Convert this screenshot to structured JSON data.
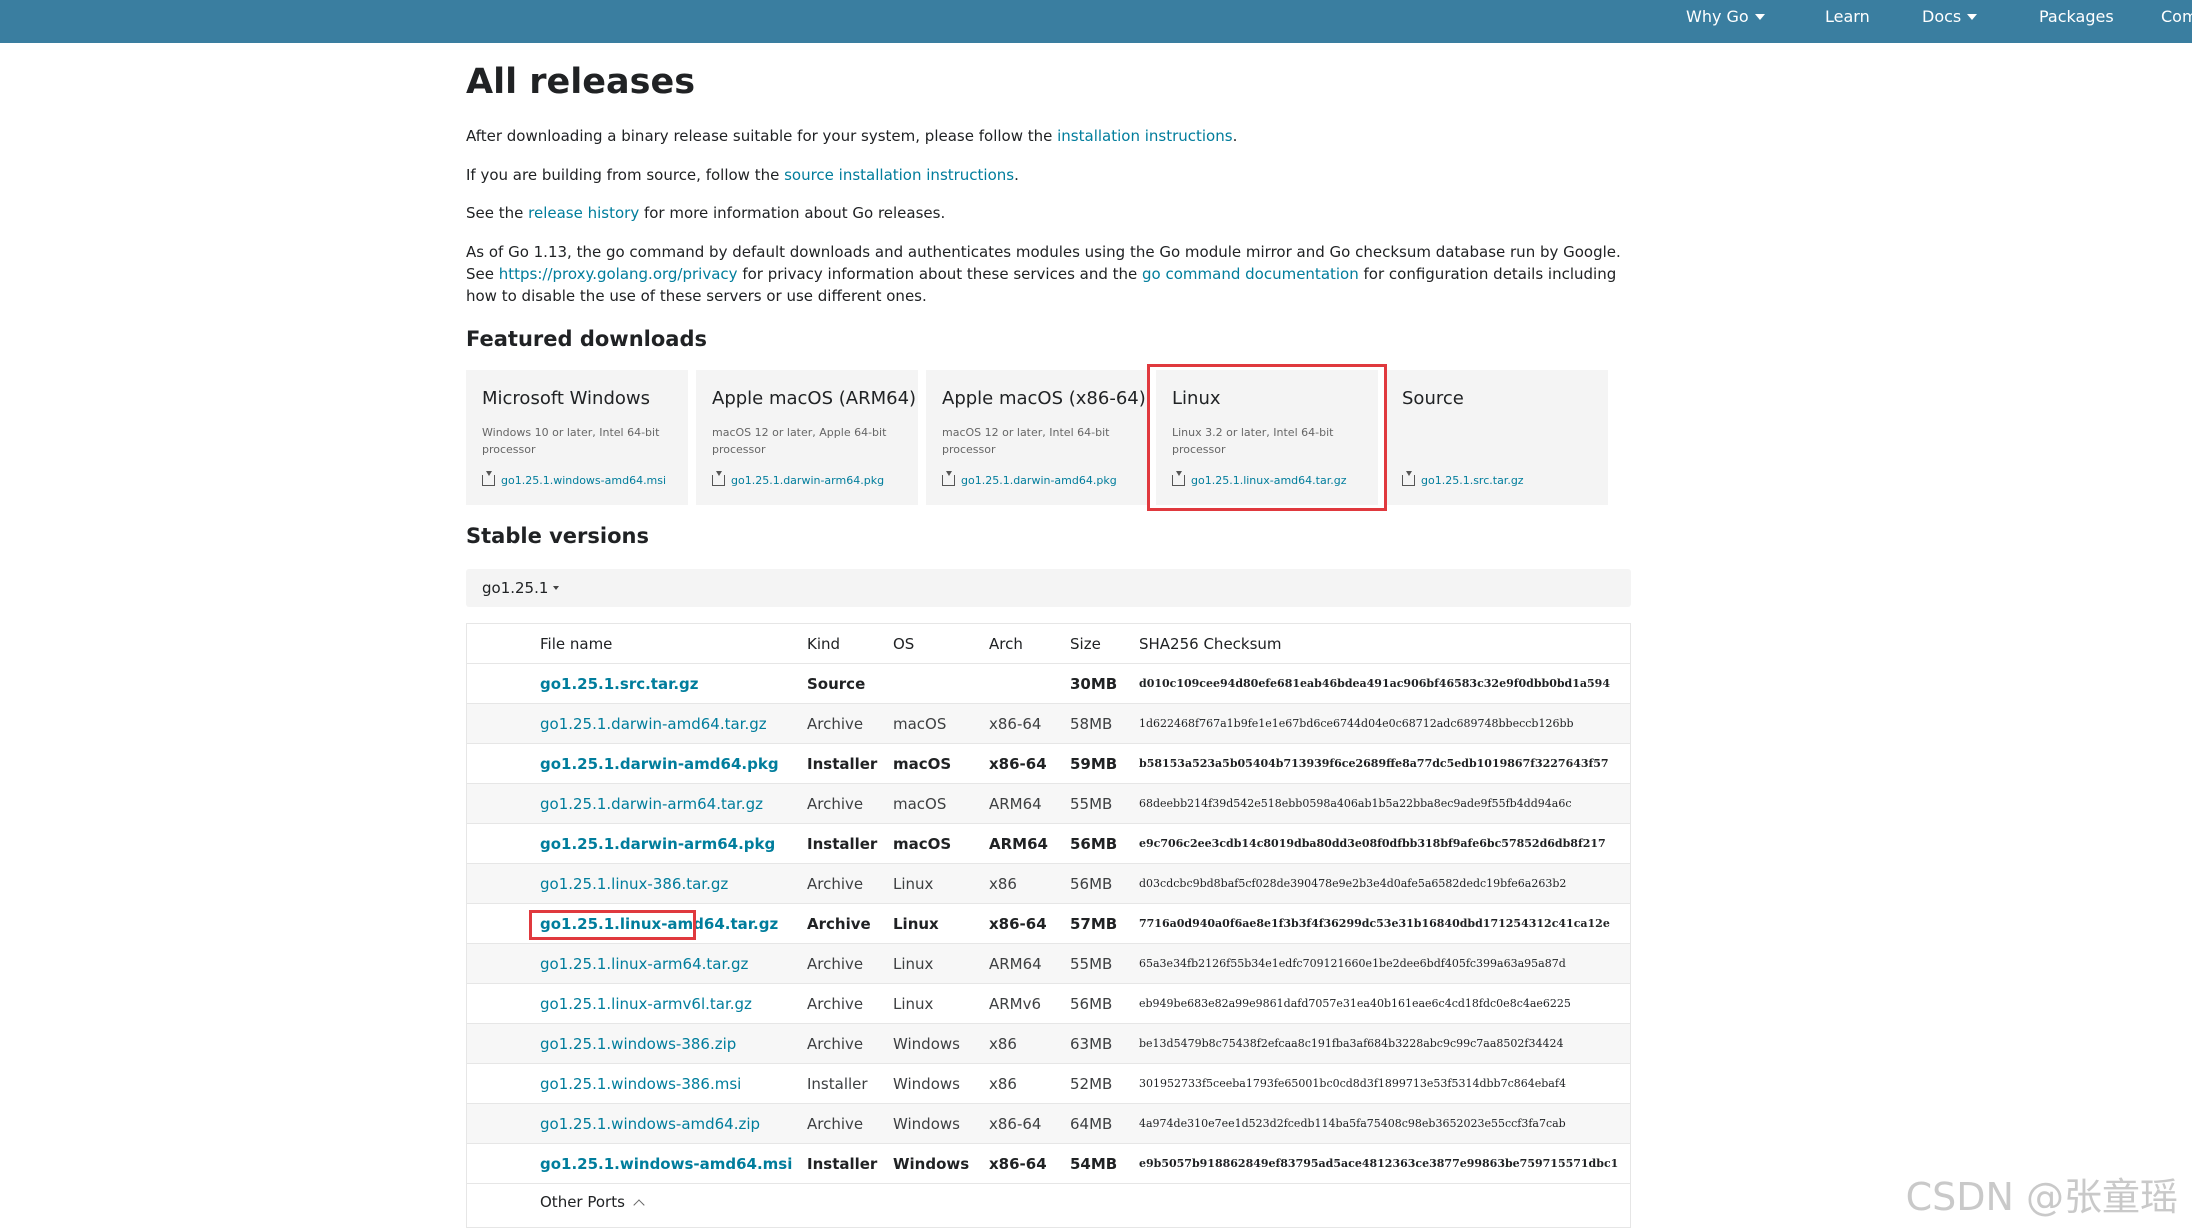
{
  "nav": {
    "items": [
      {
        "label": "Why Go",
        "dropdown": true
      },
      {
        "label": "Learn",
        "dropdown": false
      },
      {
        "label": "Docs",
        "dropdown": true
      },
      {
        "label": "Packages",
        "dropdown": false
      },
      {
        "label": "Com",
        "dropdown": false
      }
    ]
  },
  "page": {
    "title": "All releases",
    "p1": {
      "before": "After downloading a binary release suitable for your system, please follow the ",
      "link": "installation instructions",
      "after": "."
    },
    "p2": {
      "before": "If you are building from source, follow the ",
      "link": "source installation instructions",
      "after": "."
    },
    "p3": {
      "before": "See the ",
      "link": "release history",
      "after": " for more information about Go releases."
    },
    "p4": {
      "before": "As of Go 1.13, the go command by default downloads and authenticates modules using the Go module mirror and Go checksum database run by Google. See ",
      "link1": "https://proxy.golang.org/privacy",
      "middle": " for privacy information about these services and the ",
      "link2": "go command documentation",
      "after": " for configuration details including how to disable the use of these servers or use different ones."
    }
  },
  "featured": {
    "heading": "Featured downloads",
    "cards": [
      {
        "title": "Microsoft Windows",
        "desc": "Windows 10 or later, Intel 64-bit processor",
        "file": "go1.25.1.windows-amd64.msi"
      },
      {
        "title": "Apple macOS (ARM64)",
        "desc": "macOS 12 or later, Apple 64-bit processor",
        "file": "go1.25.1.darwin-arm64.pkg"
      },
      {
        "title": "Apple macOS (x86-64)",
        "desc": "macOS 12 or later, Intel 64-bit processor",
        "file": "go1.25.1.darwin-amd64.pkg"
      },
      {
        "title": "Linux",
        "desc": "Linux 3.2 or later, Intel 64-bit processor",
        "file": "go1.25.1.linux-amd64.tar.gz"
      },
      {
        "title": "Source",
        "desc": "",
        "file": "go1.25.1.src.tar.gz"
      }
    ]
  },
  "stable": {
    "heading": "Stable versions",
    "version": "go1.25.1",
    "headers": {
      "file": "File name",
      "kind": "Kind",
      "os": "OS",
      "arch": "Arch",
      "size": "Size",
      "checksum": "SHA256 Checksum"
    },
    "rows": [
      {
        "file": "go1.25.1.src.tar.gz",
        "kind": "Source",
        "os": "",
        "arch": "",
        "size": "30MB",
        "checksum": "d010c109cee94d80efe681eab46bdea491ac906bf46583c32e9f0dbb0bd1a594",
        "bold": true
      },
      {
        "file": "go1.25.1.darwin-amd64.tar.gz",
        "kind": "Archive",
        "os": "macOS",
        "arch": "x86-64",
        "size": "58MB",
        "checksum": "1d622468f767a1b9fe1e1e67bd6ce6744d04e0c68712adc689748bbeccb126bb",
        "bold": false
      },
      {
        "file": "go1.25.1.darwin-amd64.pkg",
        "kind": "Installer",
        "os": "macOS",
        "arch": "x86-64",
        "size": "59MB",
        "checksum": "b58153a523a5b05404b713939f6ce2689ffe8a77dc5edb1019867f3227643f57",
        "bold": true
      },
      {
        "file": "go1.25.1.darwin-arm64.tar.gz",
        "kind": "Archive",
        "os": "macOS",
        "arch": "ARM64",
        "size": "55MB",
        "checksum": "68deebb214f39d542e518ebb0598a406ab1b5a22bba8ec9ade9f55fb4dd94a6c",
        "bold": false
      },
      {
        "file": "go1.25.1.darwin-arm64.pkg",
        "kind": "Installer",
        "os": "macOS",
        "arch": "ARM64",
        "size": "56MB",
        "checksum": "e9c706c2ee3cdb14c8019dba80dd3e08f0dfbb318bf9afe6bc57852d6db8f217",
        "bold": true
      },
      {
        "file": "go1.25.1.linux-386.tar.gz",
        "kind": "Archive",
        "os": "Linux",
        "arch": "x86",
        "size": "56MB",
        "checksum": "d03cdcbc9bd8baf5cf028de390478e9e2b3e4d0afe5a6582dedc19bfe6a263b2",
        "bold": false
      },
      {
        "file": "go1.25.1.linux-amd64.tar.gz",
        "kind": "Archive",
        "os": "Linux",
        "arch": "x86-64",
        "size": "57MB",
        "checksum": "7716a0d940a0f6ae8e1f3b3f4f36299dc53e31b16840dbd171254312c41ca12e",
        "bold": true
      },
      {
        "file": "go1.25.1.linux-arm64.tar.gz",
        "kind": "Archive",
        "os": "Linux",
        "arch": "ARM64",
        "size": "55MB",
        "checksum": "65a3e34fb2126f55b34e1edfc709121660e1be2dee6bdf405fc399a63a95a87d",
        "bold": false
      },
      {
        "file": "go1.25.1.linux-armv6l.tar.gz",
        "kind": "Archive",
        "os": "Linux",
        "arch": "ARMv6",
        "size": "56MB",
        "checksum": "eb949be683e82a99e9861dafd7057e31ea40b161eae6c4cd18fdc0e8c4ae6225",
        "bold": false
      },
      {
        "file": "go1.25.1.windows-386.zip",
        "kind": "Archive",
        "os": "Windows",
        "arch": "x86",
        "size": "63MB",
        "checksum": "be13d5479b8c75438f2efcaa8c191fba3af684b3228abc9c99c7aa8502f34424",
        "bold": false
      },
      {
        "file": "go1.25.1.windows-386.msi",
        "kind": "Installer",
        "os": "Windows",
        "arch": "x86",
        "size": "52MB",
        "checksum": "301952733f5ceeba1793fe65001bc0cd8d3f1899713e53f5314dbb7c864ebaf4",
        "bold": false
      },
      {
        "file": "go1.25.1.windows-amd64.zip",
        "kind": "Archive",
        "os": "Windows",
        "arch": "x86-64",
        "size": "64MB",
        "checksum": "4a974de310e7ee1d523d2fcedb114ba5fa75408c98eb3652023e55ccf3fa7cab",
        "bold": false
      },
      {
        "file": "go1.25.1.windows-amd64.msi",
        "kind": "Installer",
        "os": "Windows",
        "arch": "x86-64",
        "size": "54MB",
        "checksum": "e9b5057b918862849ef83795ad5ace4812363ce3877e99863be759715571dbc1",
        "bold": true
      }
    ],
    "other_ports": "Other Ports"
  },
  "watermark": "CSDN @张童瑶",
  "colors": {
    "nav": "#3a7ea0",
    "link": "#007d9c",
    "highlight": "#e0393e",
    "card_bg": "#f4f4f4"
  }
}
